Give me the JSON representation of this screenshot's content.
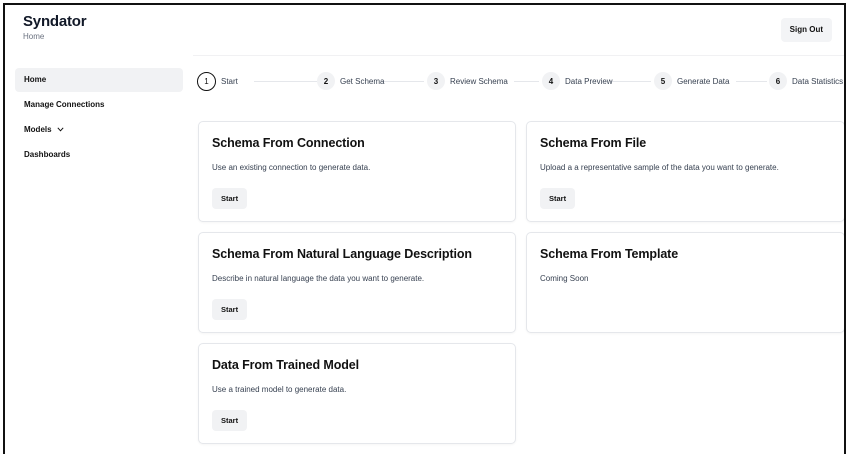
{
  "header": {
    "app_name": "Syndator",
    "breadcrumb": "Home",
    "sign_out_label": "Sign Out"
  },
  "sidebar": {
    "items": [
      {
        "label": "Home",
        "active": true
      },
      {
        "label": "Manage Connections",
        "active": false
      },
      {
        "label": "Models",
        "active": false,
        "icon": "chevron-down-icon"
      },
      {
        "label": "Dashboards",
        "active": false
      }
    ]
  },
  "stepper": {
    "steps": [
      {
        "number": "1",
        "label": "Start",
        "active": true
      },
      {
        "number": "2",
        "label": "Get Schema",
        "active": false
      },
      {
        "number": "3",
        "label": "Review Schema",
        "active": false
      },
      {
        "number": "4",
        "label": "Data Preview",
        "active": false
      },
      {
        "number": "5",
        "label": "Generate Data",
        "active": false
      },
      {
        "number": "6",
        "label": "Data Statistics",
        "active": false
      }
    ]
  },
  "cards": [
    {
      "title": "Schema From Connection",
      "description": "Use an existing connection to generate data.",
      "button": "Start"
    },
    {
      "title": "Schema From File",
      "description": "Upload a a representative sample of the data you want to generate.",
      "button": "Start"
    },
    {
      "title": "Schema From Natural Language Description",
      "description": "Describe in natural language the data you want to generate.",
      "button": "Start"
    },
    {
      "title": "Schema From Template",
      "description": "Coming Soon",
      "button": null
    },
    {
      "title": "Data From Trained Model",
      "description": "Use a trained model to generate data.",
      "button": "Start"
    }
  ]
}
